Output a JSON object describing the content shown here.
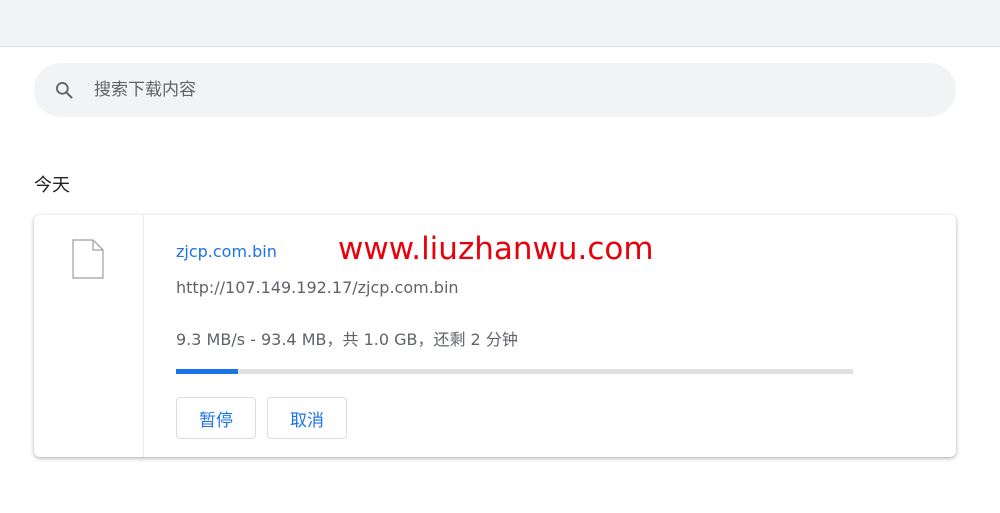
{
  "search": {
    "placeholder": "搜索下载内容",
    "icon": "search-icon"
  },
  "section": {
    "title": "今天"
  },
  "download": {
    "file_icon": "file-icon",
    "file_name": "zjcp.com.bin",
    "watermark": "www.liuzhanwu.com",
    "url": "http://107.149.192.17/zjcp.com.bin",
    "status": "9.3 MB/s - 93.4 MB，共 1.0 GB，还剩 2 分钟",
    "progress_fraction": 0.0912,
    "pause_label": "暂停",
    "cancel_label": "取消"
  },
  "colors": {
    "accent": "#1a73e8",
    "watermark": "#e8000b",
    "track": "#e0e0e0"
  }
}
